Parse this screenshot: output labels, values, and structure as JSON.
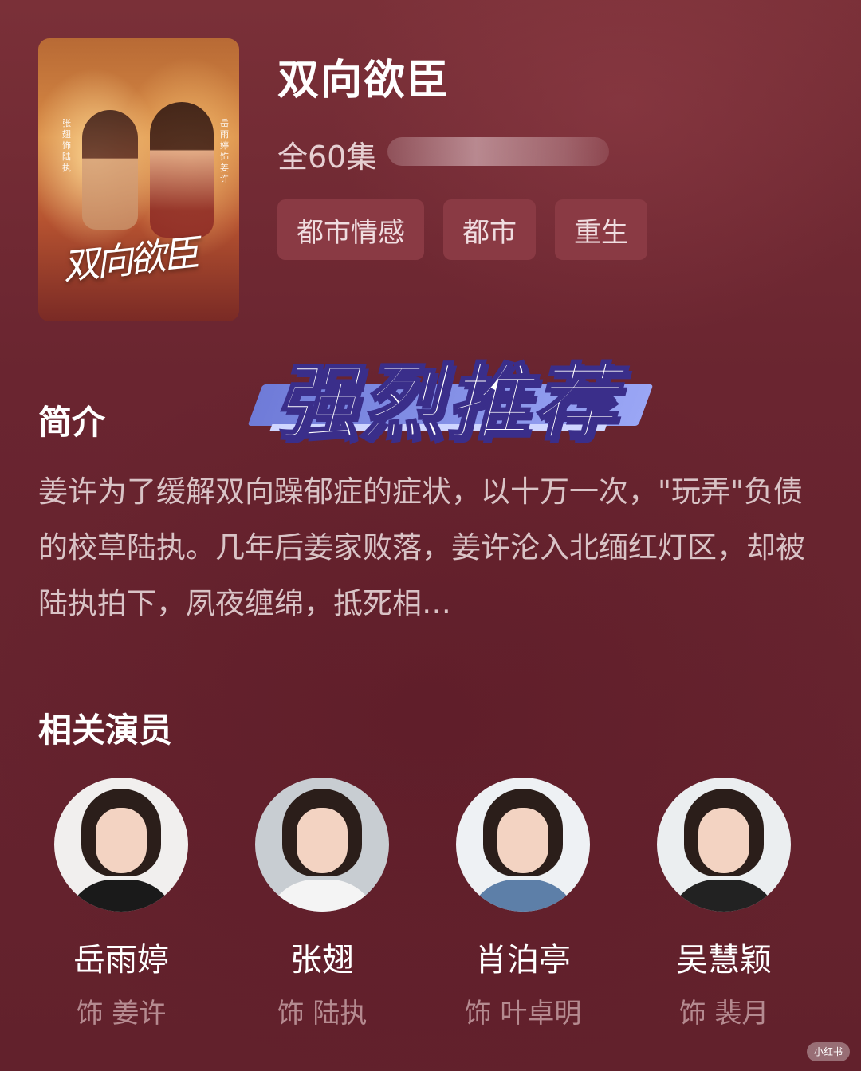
{
  "drama": {
    "title": "双向欲臣",
    "episodes": "全60集",
    "tags": [
      "都市情感",
      "都市",
      "重生"
    ]
  },
  "poster": {
    "title_art": "双向欲臣",
    "left_credit": "张翅 饰 陆执",
    "right_credit": "岳雨婷 饰 姜许"
  },
  "badge": {
    "text": "强烈推荐"
  },
  "synopsis": {
    "heading": "简介",
    "text": "姜许为了缓解双向躁郁症的症状，以十万一次，\"玩弄\"负债的校草陆执。几年后姜家败落，姜许沦入北缅红灯区，却被陆执拍下，夙夜缠绵，抵死相…"
  },
  "cast": {
    "heading": "相关演员",
    "actors": [
      {
        "name": "岳雨婷",
        "role": "饰 姜许",
        "shirt": "#1a1a1a",
        "bg": "#f1efee"
      },
      {
        "name": "张翅",
        "role": "饰 陆执",
        "shirt": "#f4f4f4",
        "bg": "#c8cdd2"
      },
      {
        "name": "肖泊亭",
        "role": "饰 叶卓明",
        "shirt": "#5d7fa8",
        "bg": "#eef1f4"
      },
      {
        "name": "吴慧颖",
        "role": "饰 裴月",
        "shirt": "#222222",
        "bg": "#ebeef0"
      }
    ]
  },
  "colors": {
    "background": "#6b2630",
    "tag_bg": "#8a3a44",
    "badge_accent": "#7b86e2",
    "role_text": "#b58a90"
  },
  "watermark": "小红书"
}
